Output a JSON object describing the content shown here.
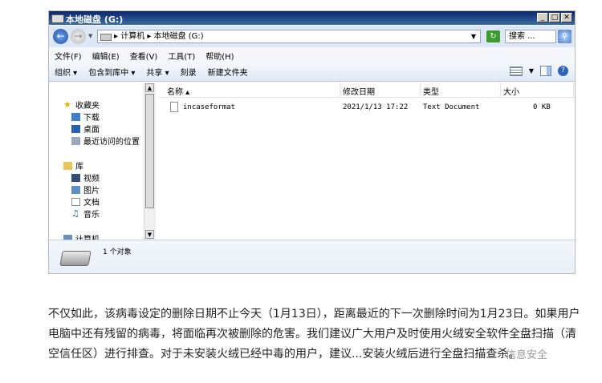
{
  "window": {
    "title": "本地磁盘 (G:)",
    "min_glyph": "_",
    "max_glyph": "□",
    "close_glyph": "✕"
  },
  "address": {
    "breadcrumb": "▸ 计算机 ▸ 本地磁盘 (G:)",
    "search_placeholder": "搜索 ..."
  },
  "menubar": [
    "文件(F)",
    "编辑(E)",
    "查看(V)",
    "工具(T)",
    "帮助(H)"
  ],
  "toolbar": [
    "组织 ▾",
    "包含到库中 ▾",
    "共享 ▾",
    "刻录",
    "新建文件夹"
  ],
  "navpane": {
    "favorites": "收藏夹",
    "downloads": "下载",
    "desktop": "桌面",
    "recent": "最近访问的位置",
    "libraries": "库",
    "videos": "视频",
    "pictures": "图片",
    "documents": "文档",
    "music": "音乐",
    "computer": "计算机"
  },
  "columns": {
    "name": "名称 ▴",
    "modified": "修改日期",
    "type": "类型",
    "size": "大小"
  },
  "files": [
    {
      "name": "incaseformat",
      "modified": "2021/1/13 17:22",
      "type": "Text Document",
      "size": "0 KB"
    }
  ],
  "details": {
    "count": "1 个对象"
  },
  "article": {
    "text": "不仅如此，该病毒设定的删除日期不止今天（1月13日），距离最近的下一次删除时间为1月23日。如果用户电脑中还有残留的病毒，将面临再次被删除的危害。我们建议广大用户及时使用火绒安全软件全盘扫描（清空信任区）进行排查。对于未安装火绒已经中毒的用户，建议...安装火绒后进行全盘扫描查杀。",
    "watermark": "信息安全"
  }
}
